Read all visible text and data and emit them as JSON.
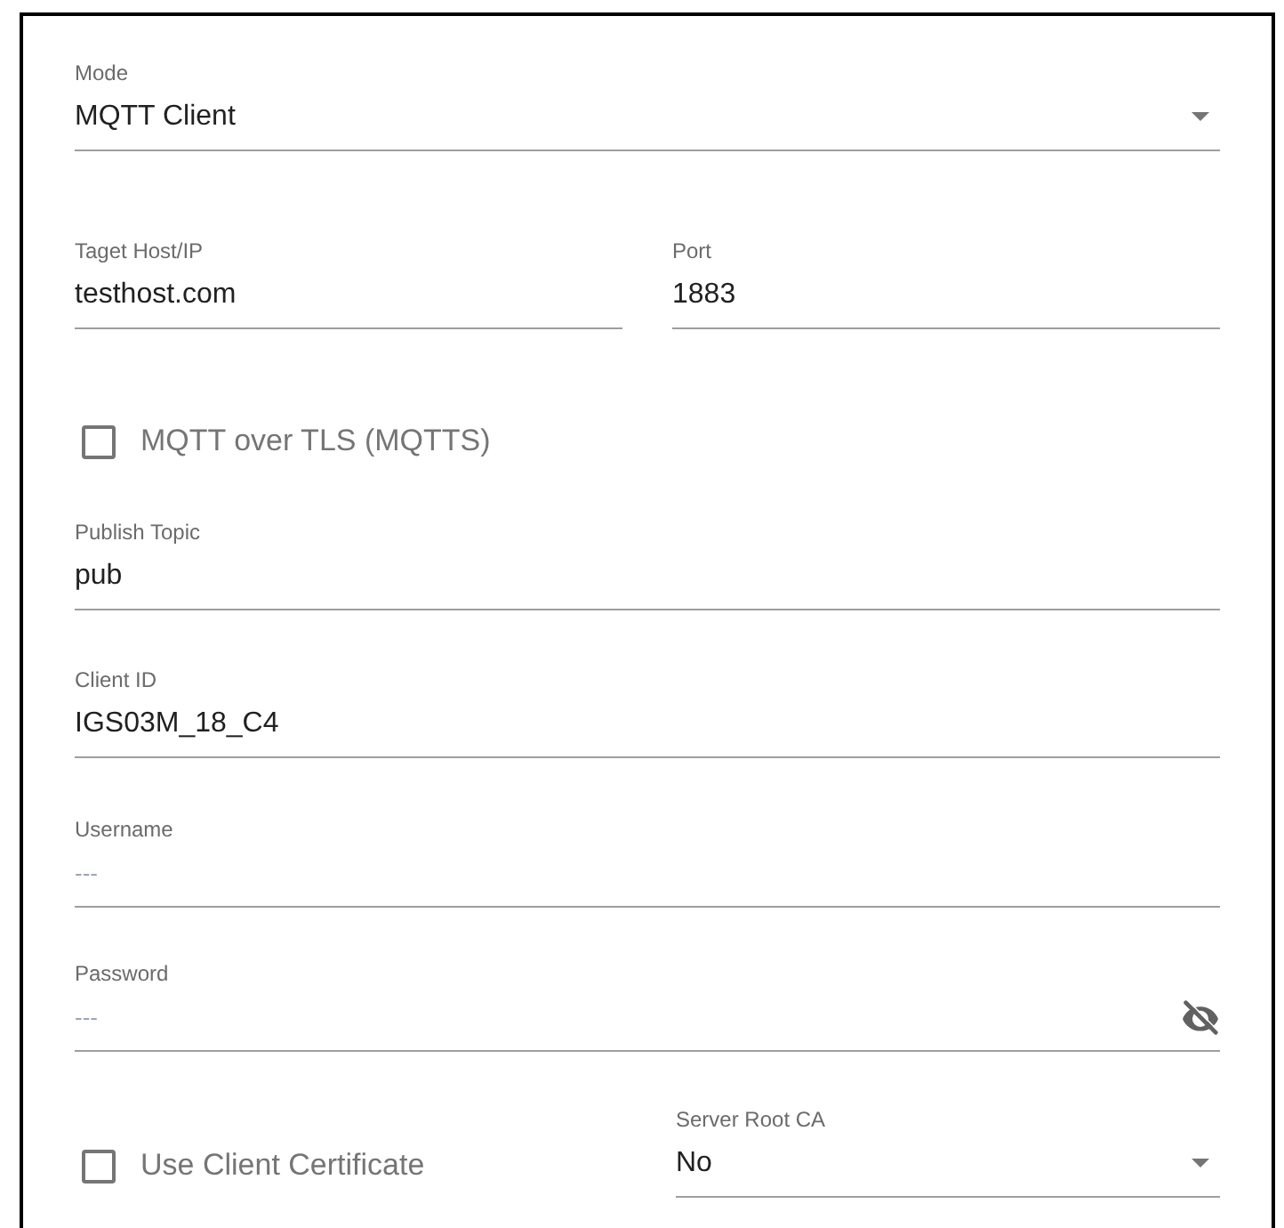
{
  "rows": [
    [
      {
        "kind": "select",
        "label": "Mode",
        "value": "MQTT Client"
      }
    ],
    [
      {
        "kind": "text",
        "label": "Taget Host/IP",
        "value": "testhost.com"
      },
      {
        "kind": "text",
        "label": "Port",
        "value": "1883"
      }
    ],
    [
      {
        "kind": "checkbox",
        "label": "MQTT over TLS (MQTTS)",
        "checked": false
      }
    ],
    [
      {
        "kind": "text",
        "label": "Publish Topic",
        "value": "pub"
      }
    ],
    [
      {
        "kind": "text",
        "label": "Client ID",
        "value": "IGS03M_18_C4"
      }
    ],
    [
      {
        "kind": "text",
        "label": "Username",
        "placeholder": "---"
      }
    ],
    [
      {
        "kind": "password",
        "label": "Password",
        "placeholder": "---"
      }
    ],
    [
      {
        "kind": "checkbox",
        "label": "Use Client Certificate",
        "checked": false
      },
      {
        "kind": "select",
        "label": "Server Root CA",
        "value": "No"
      }
    ]
  ]
}
